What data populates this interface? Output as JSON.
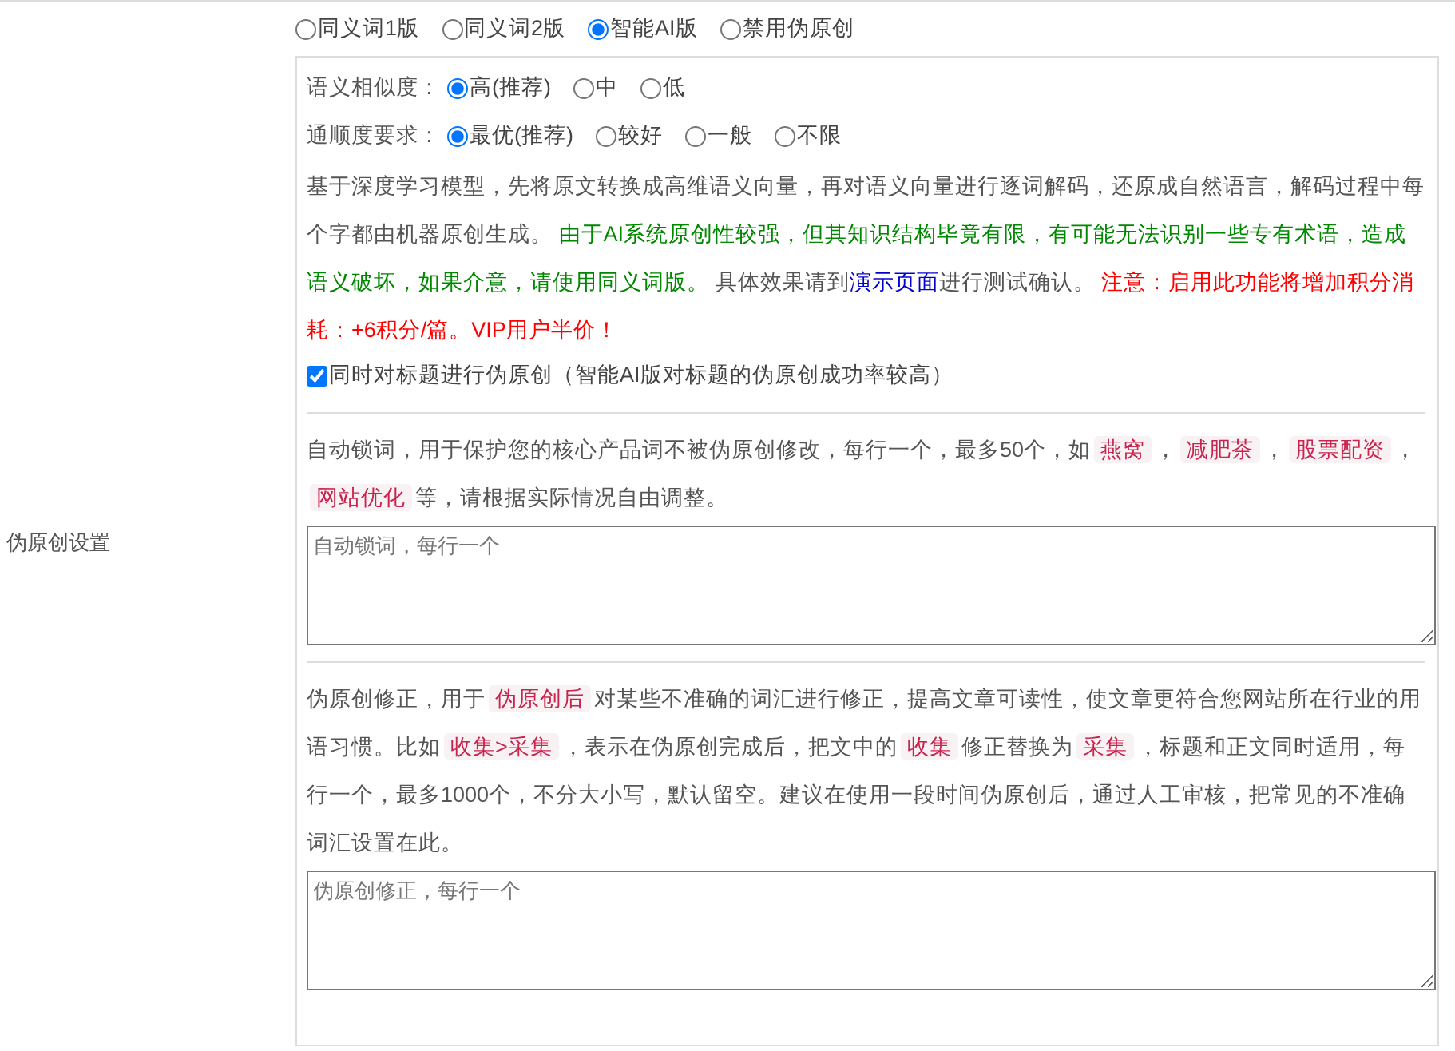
{
  "modes": [
    {
      "label": "同义词1版",
      "selected": false
    },
    {
      "label": "同义词2版",
      "selected": false
    },
    {
      "label": "智能AI版",
      "selected": true
    },
    {
      "label": "禁用伪原创",
      "selected": false
    }
  ],
  "side_label": "伪原创设置",
  "option_groups": [
    {
      "label": "语义相似度：",
      "options": [
        {
          "label": "高(推荐)",
          "selected": true
        },
        {
          "label": "中",
          "selected": false
        },
        {
          "label": "低",
          "selected": false
        }
      ]
    },
    {
      "label": "通顺度要求：",
      "options": [
        {
          "label": "最优(推荐)",
          "selected": true
        },
        {
          "label": "较好",
          "selected": false
        },
        {
          "label": "一般",
          "selected": false
        },
        {
          "label": "不限",
          "selected": false
        }
      ]
    }
  ],
  "ai_description": [
    {
      "kind": "plain",
      "text": "基于深度学习模型，先将原文转换成高维语义向量，再对语义向量进行逐词解码，还原成自然语言，解码过程中每个字都由机器原创生成。 "
    },
    {
      "kind": "note",
      "text": "由于AI系统原创性较强，但其知识结构毕竟有限，有可能无法识别一些专有术语，造成语义破坏，如果介意，请使用同义词版。"
    },
    {
      "kind": "plain",
      "text": " 具体效果请到"
    },
    {
      "kind": "link",
      "text": "演示页面"
    },
    {
      "kind": "plain",
      "text": "进行测试确认。 "
    },
    {
      "kind": "warning",
      "text": "注意：启用此功能将增加积分消耗：+6积分/篇。VIP用户半价！"
    }
  ],
  "title_option": {
    "label": "同时对标题进行伪原创（智能AI版对标题的伪原创成功率较高）",
    "checked": true
  },
  "lock_words": {
    "description": [
      {
        "kind": "plain",
        "text": "自动锁词，用于保护您的核心产品词不被伪原创修改，每行一个，最多50个，如"
      },
      {
        "kind": "tag",
        "text": "燕窝"
      },
      {
        "kind": "plain",
        "text": "，"
      },
      {
        "kind": "tag",
        "text": "减肥茶"
      },
      {
        "kind": "plain",
        "text": "，"
      },
      {
        "kind": "tag",
        "text": "股票配资"
      },
      {
        "kind": "plain",
        "text": "，"
      },
      {
        "kind": "tag",
        "text": "网站优化"
      },
      {
        "kind": "plain",
        "text": "等，请根据实际情况自由调整。"
      }
    ],
    "placeholder": "自动锁词，每行一个"
  },
  "corrections": {
    "description": [
      {
        "kind": "plain",
        "text": "伪原创修正，用于"
      },
      {
        "kind": "tag",
        "text": "伪原创后"
      },
      {
        "kind": "plain",
        "text": "对某些不准确的词汇进行修正，提高文章可读性，使文章更符合您网站所在行业的用语习惯。比如"
      },
      {
        "kind": "tag",
        "text": "收集>采集"
      },
      {
        "kind": "plain",
        "text": "，表示在伪原创完成后，把文中的"
      },
      {
        "kind": "tag",
        "text": "收集"
      },
      {
        "kind": "plain",
        "text": "修正替换为"
      },
      {
        "kind": "tag",
        "text": "采集"
      },
      {
        "kind": "plain",
        "text": "，标题和正文同时适用，每行一个，最多1000个，不分大小写，默认留空。建议在使用一段时间伪原创后，通过人工审核，把常见的不准确词汇设置在此。"
      }
    ],
    "placeholder": "伪原创修正，每行一个"
  }
}
